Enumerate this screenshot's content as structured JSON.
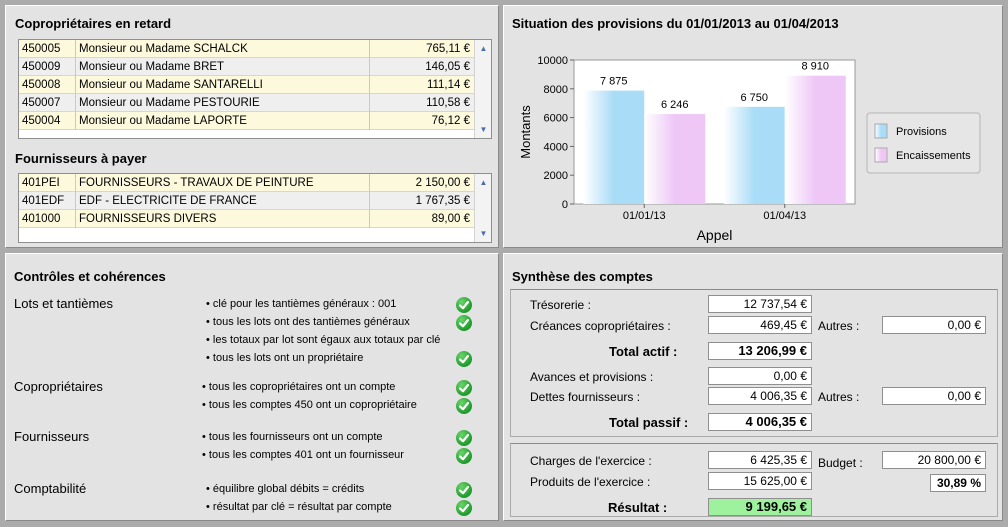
{
  "retard": {
    "title": "Copropriétaires en retard",
    "rows": [
      {
        "code": "450005",
        "name": "Monsieur ou Madame SCHALCK",
        "amount": "765,11 €"
      },
      {
        "code": "450009",
        "name": "Monsieur ou Madame BRET",
        "amount": "146,05 €"
      },
      {
        "code": "450008",
        "name": "Monsieur ou Madame SANTARELLI",
        "amount": "111,14 €"
      },
      {
        "code": "450007",
        "name": "Monsieur ou Madame PESTOURIE",
        "amount": "110,58 €"
      },
      {
        "code": "450004",
        "name": "Monsieur ou Madame LAPORTE",
        "amount": "76,12 €"
      }
    ]
  },
  "fournisseurs": {
    "title": "Fournisseurs à payer",
    "rows": [
      {
        "code": "401PEI",
        "name": "FOURNISSEURS - TRAVAUX DE  PEINTURE",
        "amount": "2 150,00 €"
      },
      {
        "code": "401EDF",
        "name": "EDF - ELECTRICITE DE FRANCE",
        "amount": "1 767,35 €"
      },
      {
        "code": "401000",
        "name": "FOURNISSEURS DIVERS",
        "amount": "89,00 €"
      }
    ]
  },
  "chart_data": {
    "type": "bar",
    "title": "Situation des provisions du 01/01/2013 au 01/04/2013",
    "categories": [
      "01/01/13",
      "01/04/13"
    ],
    "series": [
      {
        "name": "Provisions",
        "values": [
          7875,
          6750
        ],
        "labels": [
          "7 875",
          "6 750"
        ],
        "color": "#a9dcf7"
      },
      {
        "name": "Encaissements",
        "values": [
          6246,
          8910
        ],
        "labels": [
          "6 246",
          "8 910"
        ],
        "color": "#eec7f6"
      }
    ],
    "xlabel": "Appel",
    "ylabel": "Montants",
    "ylim": [
      0,
      10000
    ],
    "yticks": [
      "0",
      "2000",
      "4000",
      "6000",
      "8000",
      "10000"
    ],
    "legend": "right",
    "grid": false
  },
  "controles": {
    "title": "Contrôles et cohérences",
    "sections": [
      {
        "label": "Lots et tantièmes",
        "items": [
          {
            "text": "• clé pour les tantièmes généraux : 001",
            "ok": true
          },
          {
            "text": "• tous les lots ont des tantièmes généraux",
            "ok": true
          },
          {
            "text": "• les totaux par lot sont égaux aux totaux par clé",
            "ok": false
          },
          {
            "text": "• tous les lots ont un propriétaire",
            "ok": true
          }
        ]
      },
      {
        "label": "Copropriétaires",
        "items": [
          {
            "text": "• tous les copropriétaires ont un compte",
            "ok": true
          },
          {
            "text": "• tous les comptes 450 ont un copropriétaire",
            "ok": true
          }
        ]
      },
      {
        "label": "Fournisseurs",
        "items": [
          {
            "text": "• tous les fournisseurs ont un compte",
            "ok": true
          },
          {
            "text": "• tous les comptes 401  ont un fournisseur",
            "ok": true
          }
        ]
      },
      {
        "label": "Comptabilité",
        "items": [
          {
            "text": "• équilibre global débits = crédits",
            "ok": true
          },
          {
            "text": "• résultat par clé = résultat par compte",
            "ok": true
          }
        ]
      }
    ]
  },
  "synthese": {
    "title": "Synthèse des comptes",
    "tresorerie_label": "Trésorerie :",
    "tresorerie": "12 737,54 €",
    "creances_label": "Créances copropriétaires :",
    "creances": "469,45 €",
    "autres_label": "Autres :",
    "autres_actif": "0,00 €",
    "total_actif_label": "Total actif :",
    "total_actif": "13 206,99 €",
    "avances_label": "Avances et provisions :",
    "avances": "0,00 €",
    "dettes_label": "Dettes fournisseurs :",
    "dettes": "4 006,35 €",
    "autres_passif": "0,00 €",
    "total_passif_label": "Total passif :",
    "total_passif": "4 006,35 €",
    "charges_label": "Charges de l'exercice :",
    "charges": "6 425,35 €",
    "budget_label": "Budget :",
    "budget": "20 800,00 €",
    "produits_label": "Produits de l'exercice :",
    "produits": "15 625,00 €",
    "pct": "30,89 %",
    "resultat_label": "Résultat :",
    "resultat": "9 199,65 €"
  }
}
